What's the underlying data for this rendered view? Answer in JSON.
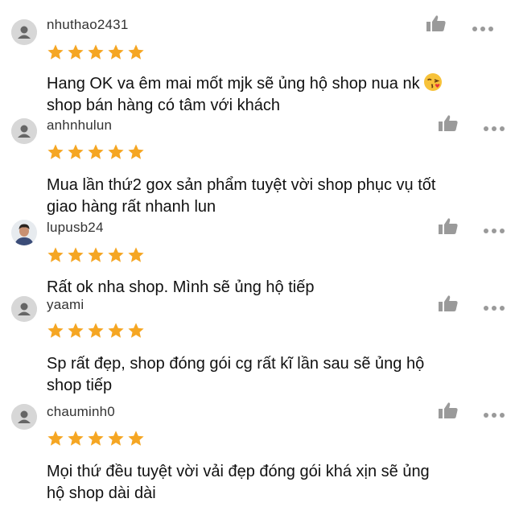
{
  "colors": {
    "star": "#f5a623",
    "icon": "#9a9a9a",
    "avatar_bg": "#d7d7d7"
  },
  "icons": {
    "like": "thumbs-up-icon",
    "more": "more-dots-icon",
    "star": "star-icon",
    "avatar": "default-avatar-icon",
    "emoji": "kissing-face-emoji"
  },
  "reviews": [
    {
      "username": "nhuthao2431",
      "rating": 5,
      "comment_lines": [
        "Hang OK va êm mai mốt mjk sẽ ủng hộ shop nua nk",
        "shop bán hàng có tâm với khách"
      ]
    },
    {
      "username": "anhnhulun",
      "rating": 5,
      "comment_lines": [
        "Mua lần thứ2 gox sản phẩm tuyệt vời shop phục vụ tốt",
        "giao hàng rất nhanh lun"
      ]
    },
    {
      "username": "lupusb24",
      "rating": 5,
      "comment_lines": [
        "Rất ok nha shop. Mình sẽ ủng hộ tiếp"
      ]
    },
    {
      "username": "yaami",
      "rating": 5,
      "comment_lines": [
        "Sp rất đẹp, shop đóng gói cg rất kĩ lần sau sẽ ủng hộ",
        "shop tiếp"
      ]
    },
    {
      "username": "chauminh0",
      "rating": 5,
      "comment_lines": [
        "Mọi thứ đều tuyệt vời vải đẹp đóng gói khá xịn sẽ ủng",
        "hộ shop dài dài"
      ]
    }
  ]
}
